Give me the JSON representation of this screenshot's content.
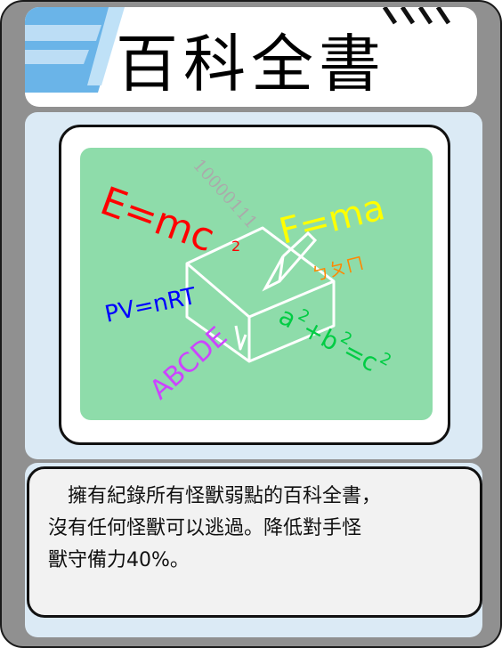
{
  "card": {
    "title": "百科全書",
    "description_lines": [
      "　擁有紀錄所有怪獸弱點的百科全書，",
      "沒有任何怪獸可以逃過。降低對手怪",
      "獸守備力40%。"
    ]
  },
  "art": {
    "formula_emc2": "E=mc",
    "formula_emc2_exp": "2",
    "formula_fma": "F=ma",
    "formula_pvnrt": "PV=nRT",
    "binary": "10000111",
    "bopomofo": "ㄅㄆㄇ",
    "letters": "ABCDE",
    "pythag_a": "a",
    "pythag_plus_b": "+b",
    "pythag_eq_c": "=c",
    "pythag_exp": "2"
  },
  "colors": {
    "card_frame": "#909090",
    "panel": "#dbeaf5",
    "board": "#8edcaa",
    "red_formula": "#ff0000",
    "yellow_formula": "#ffff00",
    "blue_formula": "#0000ff",
    "purple_letters": "#cc44ff",
    "green_formula": "#00cc44",
    "orange_bopomofo": "#ff8800"
  }
}
